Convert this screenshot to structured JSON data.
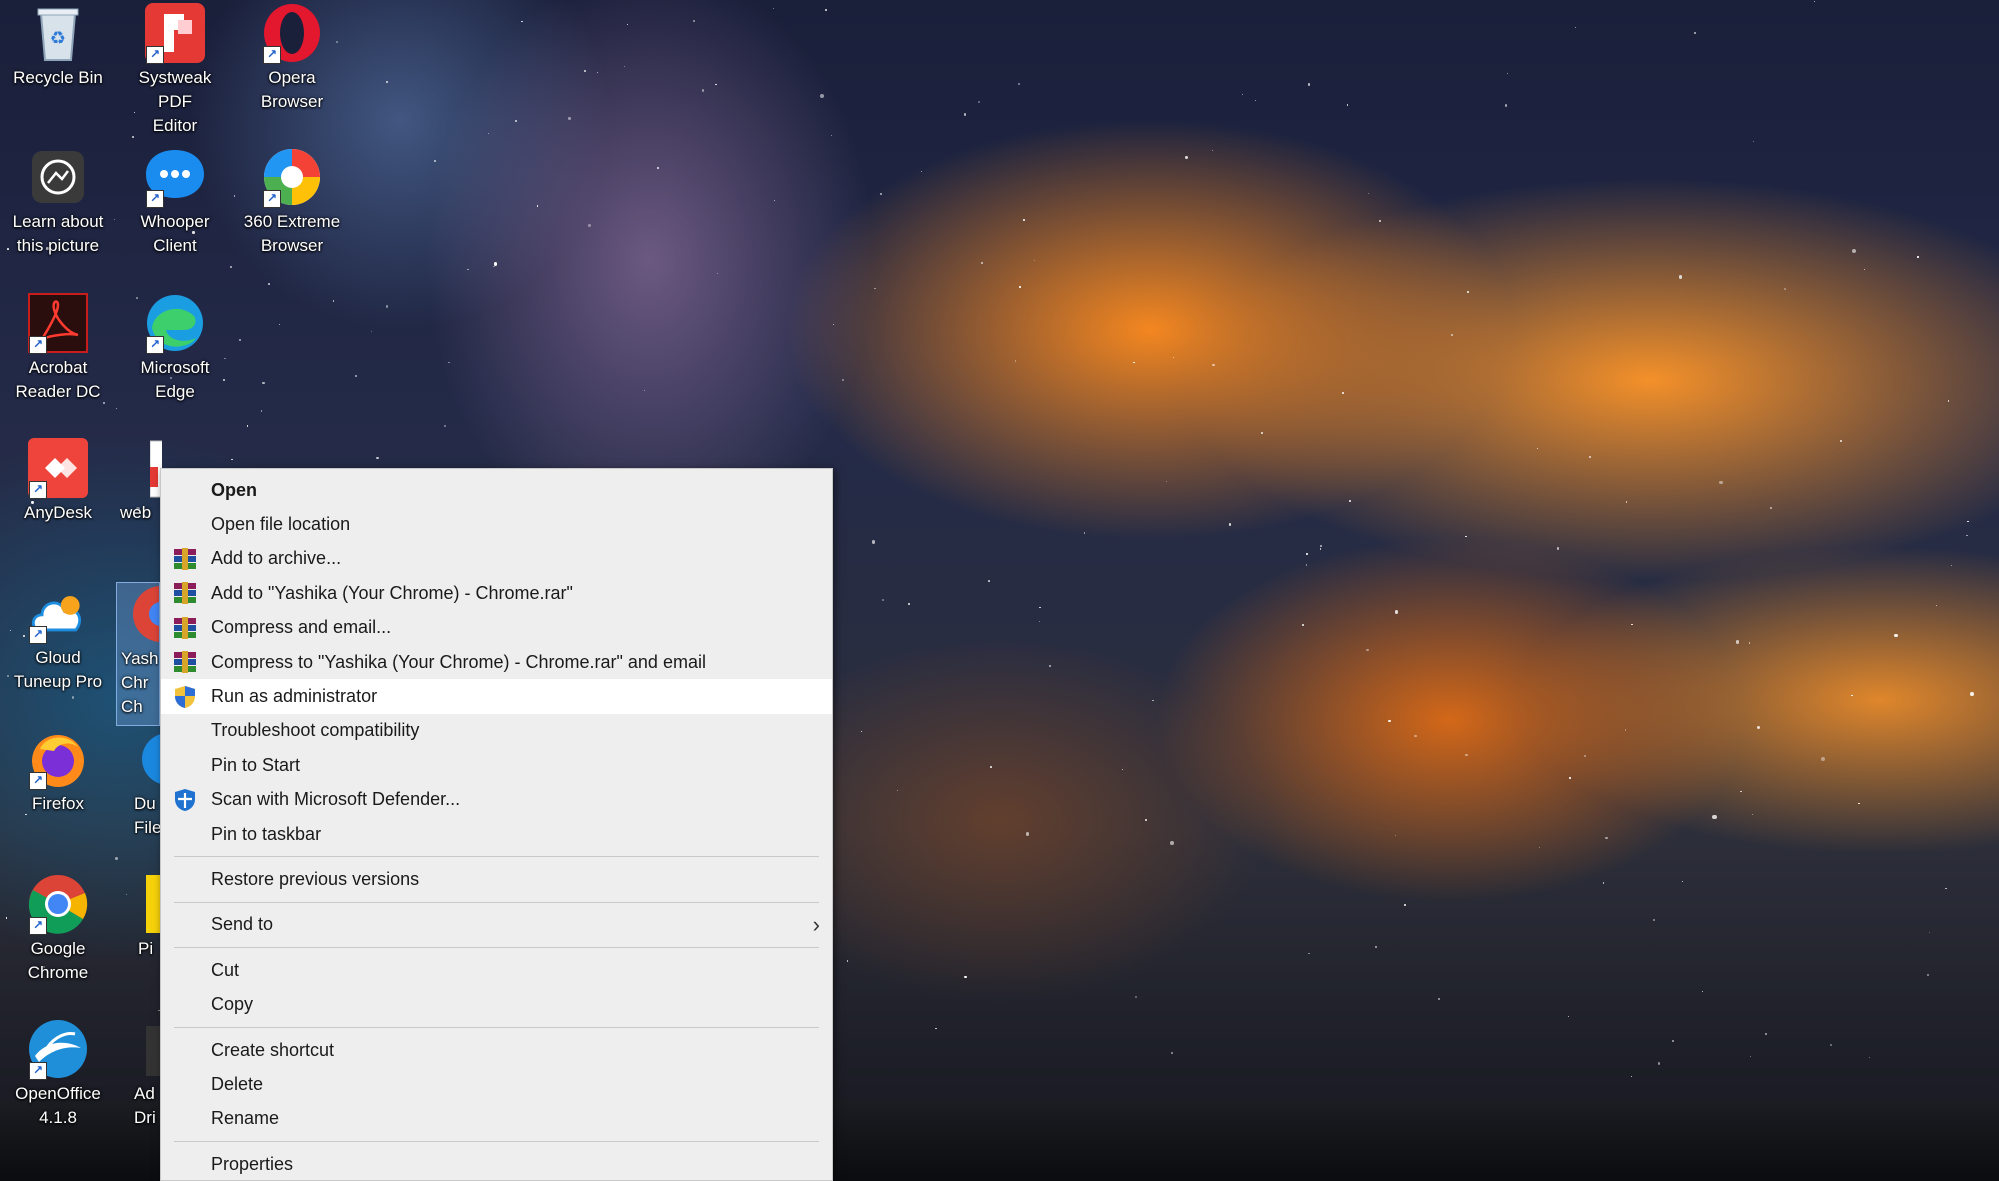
{
  "desktop": {
    "icons": [
      {
        "label": "Recycle Bin"
      },
      {
        "label": "Systweak PDF\nEditor"
      },
      {
        "label": "Opera\nBrowser"
      },
      {
        "label": "Learn about\nthis picture"
      },
      {
        "label": "Whooper\nClient"
      },
      {
        "label": "360 Extreme\nBrowser"
      },
      {
        "label": "Acrobat\nReader DC"
      },
      {
        "label": "Microsoft\nEdge"
      },
      {
        "label": "AnyDesk"
      },
      {
        "label": "web"
      },
      {
        "label": "Gloud\nTuneup Pro"
      },
      {
        "label": "Yash\nChr\nCh"
      },
      {
        "label": "Firefox"
      },
      {
        "label": "Du\nFile"
      },
      {
        "label": "Google\nChrome"
      },
      {
        "label": "Pi"
      },
      {
        "label": "OpenOffice\n4.1.8"
      },
      {
        "label": "Ad\nDri"
      }
    ]
  },
  "context_menu": {
    "items": [
      {
        "label": "Open"
      },
      {
        "label": "Open file location"
      },
      {
        "label": "Add to archive..."
      },
      {
        "label": "Add to \"Yashika (Your Chrome) - Chrome.rar\""
      },
      {
        "label": "Compress and email..."
      },
      {
        "label": "Compress to \"Yashika (Your Chrome) - Chrome.rar\" and email"
      },
      {
        "label": "Run as administrator"
      },
      {
        "label": "Troubleshoot compatibility"
      },
      {
        "label": "Pin to Start"
      },
      {
        "label": "Scan with Microsoft Defender..."
      },
      {
        "label": "Pin to taskbar"
      },
      {
        "label": "Restore previous versions"
      },
      {
        "label": "Send to"
      },
      {
        "label": "Cut"
      },
      {
        "label": "Copy"
      },
      {
        "label": "Create shortcut"
      },
      {
        "label": "Delete"
      },
      {
        "label": "Rename"
      },
      {
        "label": "Properties"
      }
    ]
  }
}
